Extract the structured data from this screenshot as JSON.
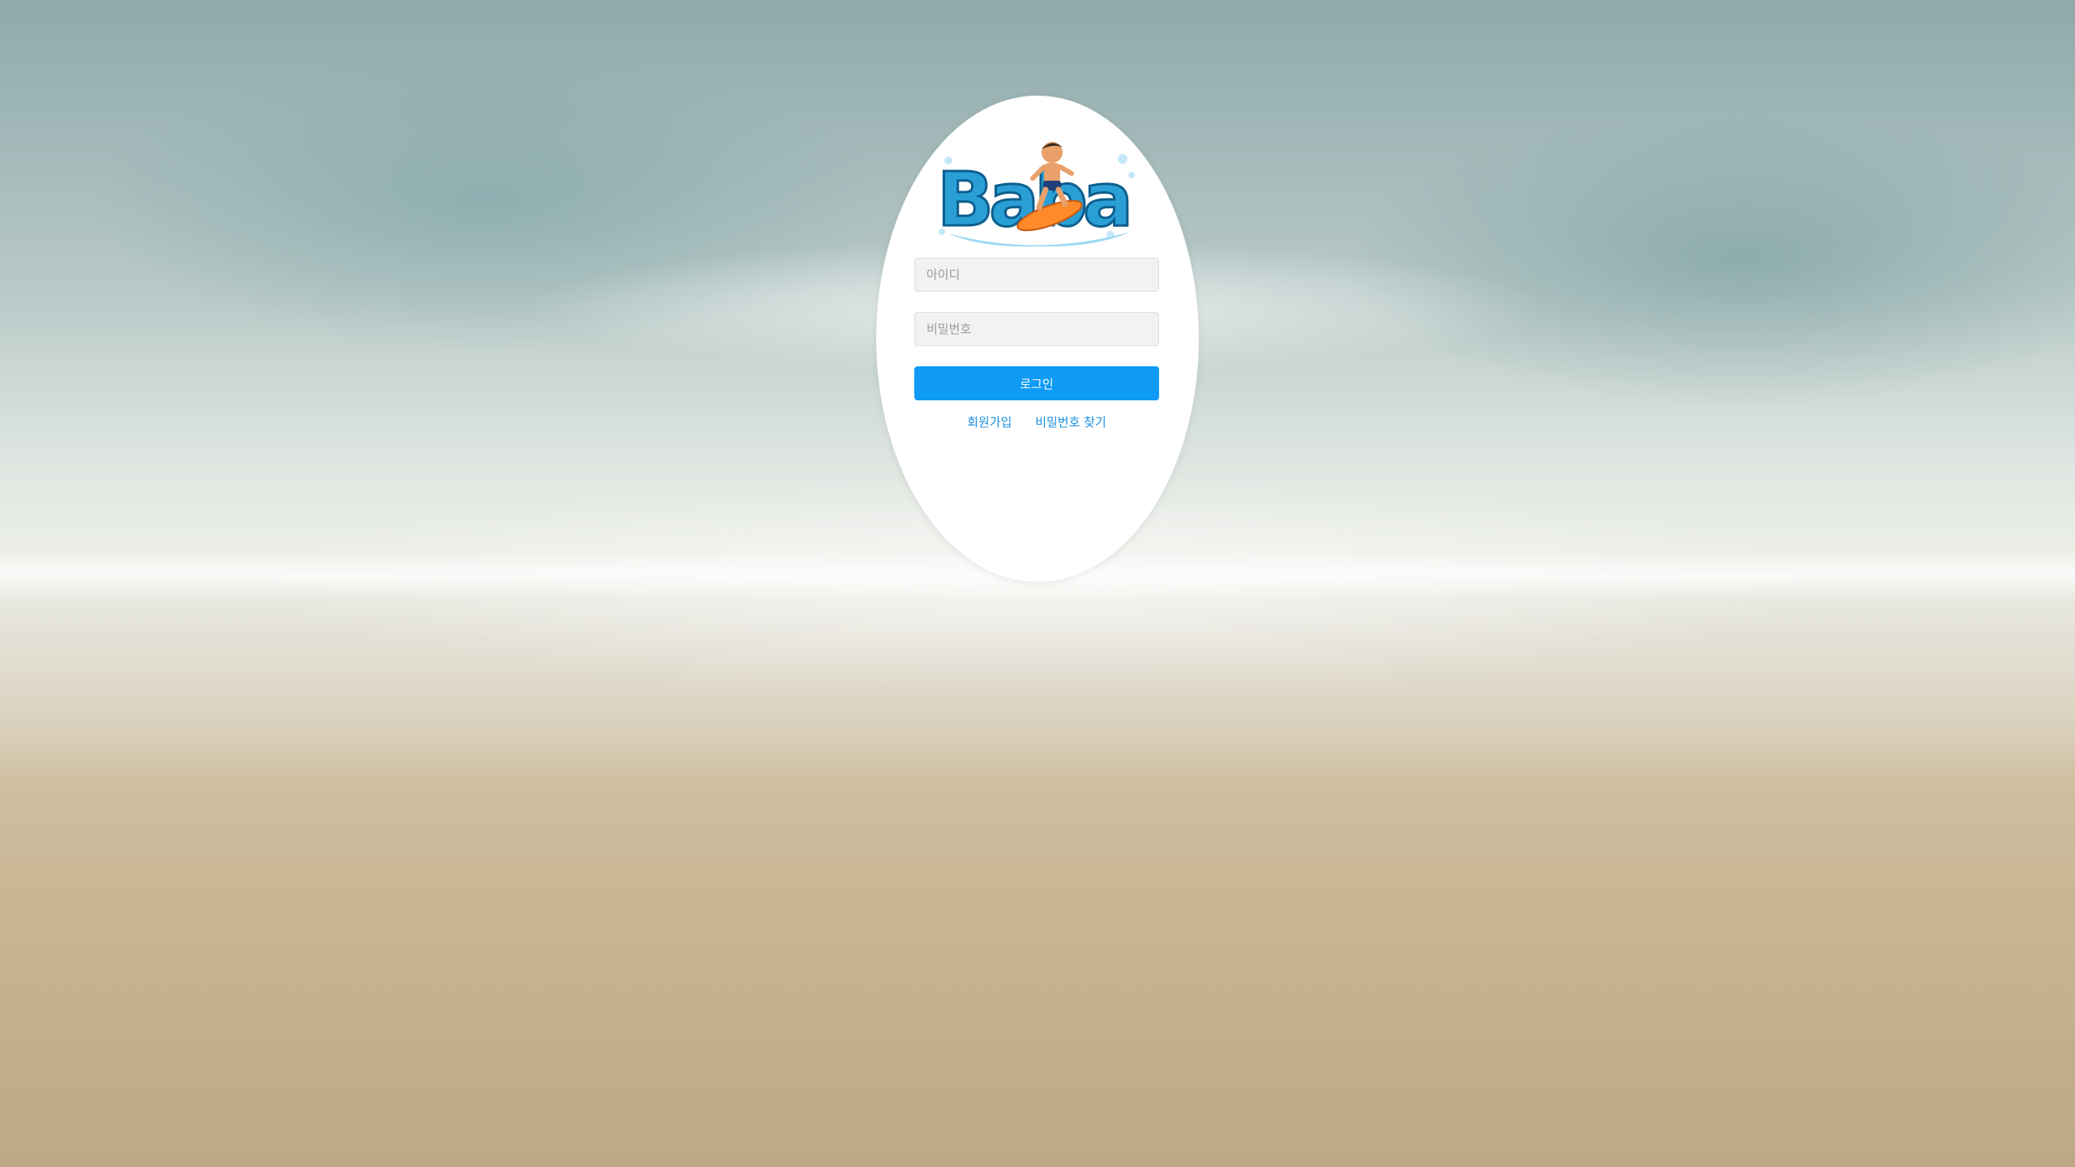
{
  "logo": {
    "text": "Baba",
    "alt": "Baba logo with surfing boy"
  },
  "form": {
    "id_placeholder": "아이디",
    "pw_placeholder": "비밀번호",
    "login_label": "로그인"
  },
  "links": {
    "signup_label": "회원가입",
    "find_password_label": "비밀번호 찾기"
  },
  "colors": {
    "accent": "#0f9bf5",
    "link": "#1a8fe0",
    "logo_blue": "#2a9fd6"
  }
}
